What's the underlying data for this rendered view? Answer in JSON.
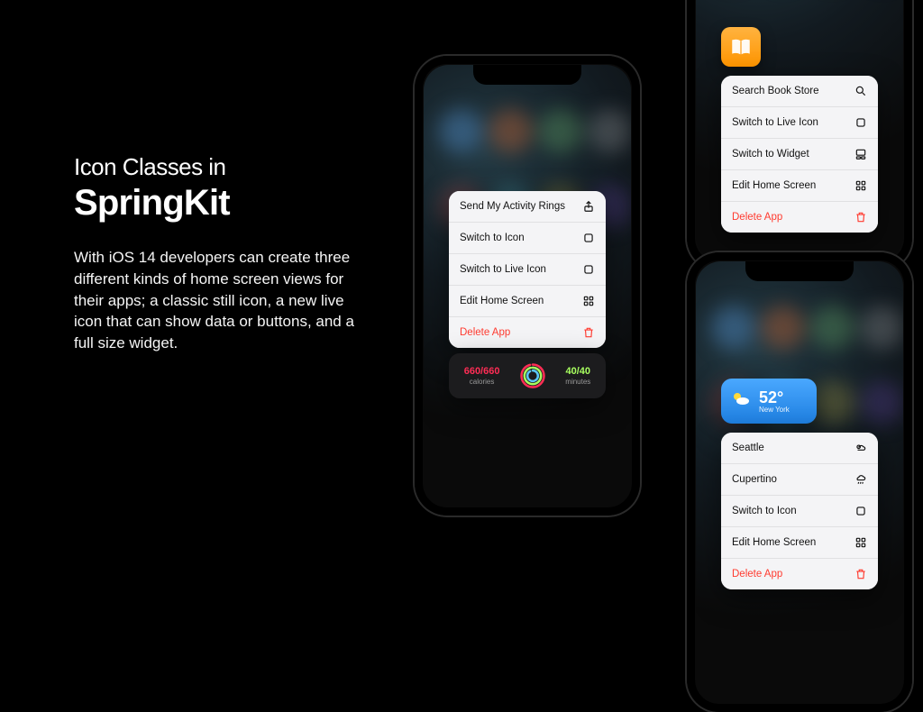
{
  "header": {
    "pre_title": "Icon Classes in",
    "title": "SpringKit",
    "body": "With iOS 14 developers can create three different kinds of home screen views for their apps; a classic still icon, a new live icon that can show data or buttons, and a full size widget."
  },
  "colors": {
    "delete": "#ff3b30",
    "calories": "#ff2d55",
    "minutes": "#a8ff60",
    "books_icon_bg": "#ff9500",
    "weather_bg": "#2a8cff"
  },
  "phone_center": {
    "menu": [
      {
        "label": "Send My Activity Rings",
        "icon": "share-icon"
      },
      {
        "label": "Switch to Icon",
        "icon": "square-icon"
      },
      {
        "label": "Switch to Live Icon",
        "icon": "square-icon"
      },
      {
        "label": "Edit Home Screen",
        "icon": "apps-icon"
      },
      {
        "label": "Delete App",
        "icon": "trash-icon",
        "delete": true
      }
    ],
    "activity": {
      "calories_value": "660/660",
      "calories_label": "calories",
      "minutes_value": "40/40",
      "minutes_label": "minutes"
    }
  },
  "phone_top_right": {
    "app_icon": "books-icon",
    "menu": [
      {
        "label": "Search Book Store",
        "icon": "search-icon"
      },
      {
        "label": "Switch to Live Icon",
        "icon": "square-icon"
      },
      {
        "label": "Switch to Widget",
        "icon": "widget-icon"
      },
      {
        "label": "Edit Home Screen",
        "icon": "apps-icon"
      },
      {
        "label": "Delete App",
        "icon": "trash-icon",
        "delete": true
      }
    ]
  },
  "phone_bottom_right": {
    "weather": {
      "temperature": "52°",
      "location": "New York",
      "icon": "partly-sunny-icon"
    },
    "menu": [
      {
        "label": "Seattle",
        "icon": "partly-cloudy-icon"
      },
      {
        "label": "Cupertino",
        "icon": "rain-icon"
      },
      {
        "label": "Switch to Icon",
        "icon": "square-icon"
      },
      {
        "label": "Edit Home Screen",
        "icon": "apps-icon"
      },
      {
        "label": "Delete App",
        "icon": "trash-icon",
        "delete": true
      }
    ]
  }
}
